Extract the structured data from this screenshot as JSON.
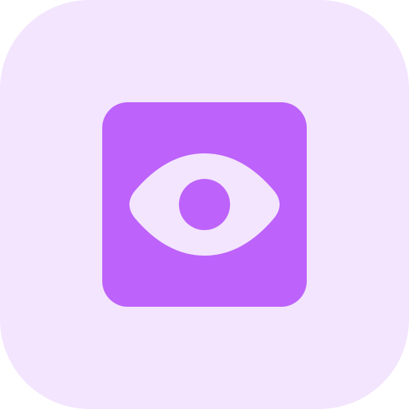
{
  "app_icon": {
    "icon_name": "eye-icon",
    "colors": {
      "background": "#f3e5fd",
      "accent": "#bd62fa",
      "foreground": "#f3e5fd"
    }
  }
}
